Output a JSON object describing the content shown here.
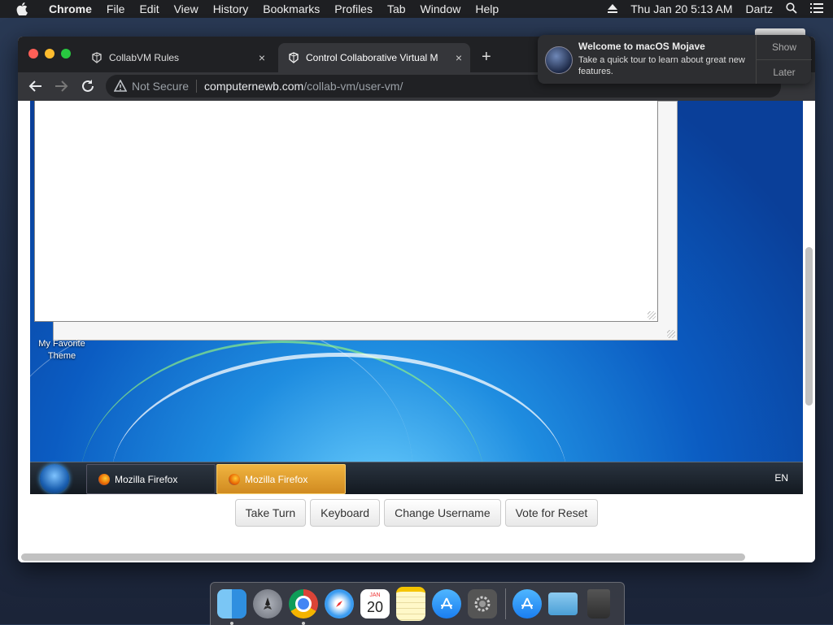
{
  "menubar": {
    "app_name": "Chrome",
    "items": [
      "File",
      "Edit",
      "View",
      "History",
      "Bookmarks",
      "Profiles",
      "Tab",
      "Window",
      "Help"
    ],
    "clock": "Thu Jan 20  5:13 AM",
    "user": "Dartz"
  },
  "notification": {
    "title": "Welcome to macOS Mojave",
    "body": "Take a quick tour to learn about great new features.",
    "show_label": "Show",
    "later_label": "Later"
  },
  "tabs": [
    {
      "title": "CollabVM Rules",
      "close": "×"
    },
    {
      "title": "Control Collaborative Virtual M",
      "close": "×"
    }
  ],
  "newtab_label": "+",
  "omnibox": {
    "security": "Not Secure",
    "host": "computernewb.com",
    "path": "/collab-vm/user-vm/"
  },
  "vm": {
    "desktop_icon_label": "My Favorite Theme",
    "taskbar": [
      {
        "label": "Mozilla Firefox",
        "active": false
      },
      {
        "label": "Mozilla Firefox",
        "active": true
      }
    ],
    "tray_lang": "EN"
  },
  "controls": [
    "Take Turn",
    "Keyboard",
    "Change Username",
    "Vote for Reset"
  ],
  "dock": {
    "calendar_day": "20",
    "calendar_month": "JAN"
  },
  "colors": {
    "taskbar_active": "#e0a030",
    "accent_blue": "#0b5cc2"
  }
}
